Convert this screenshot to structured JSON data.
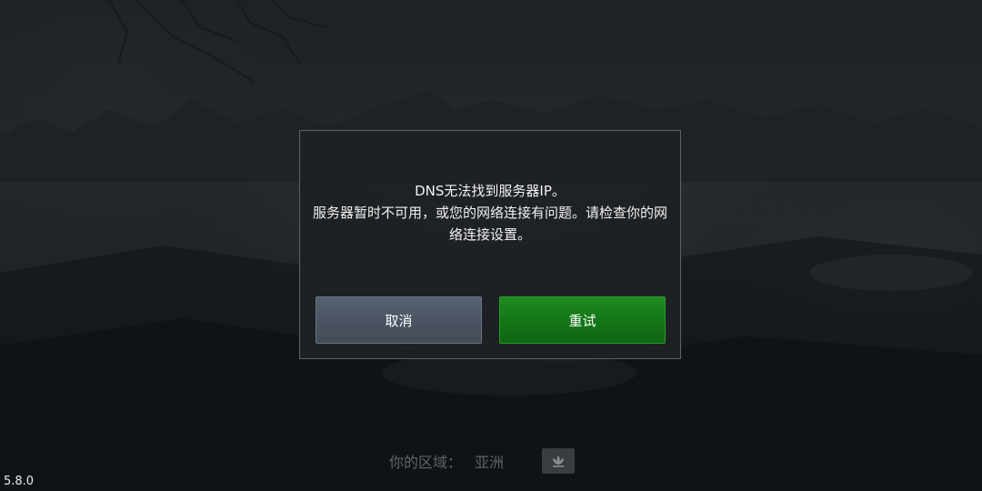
{
  "dialog": {
    "message_line1": "DNS无法找到服务器IP。",
    "message_line2": "服务器暂时不可用，或您的网络连接有问题。请检查你的网络连接设置。",
    "cancel_label": "取消",
    "retry_label": "重试"
  },
  "region": {
    "label": "你的区域：",
    "value": "亚洲",
    "icon": "lotus-flag-icon"
  },
  "version": "5.8.0",
  "colors": {
    "retry_button": "#137416",
    "cancel_button": "#4a5361",
    "dialog_background": "#1e2124"
  }
}
